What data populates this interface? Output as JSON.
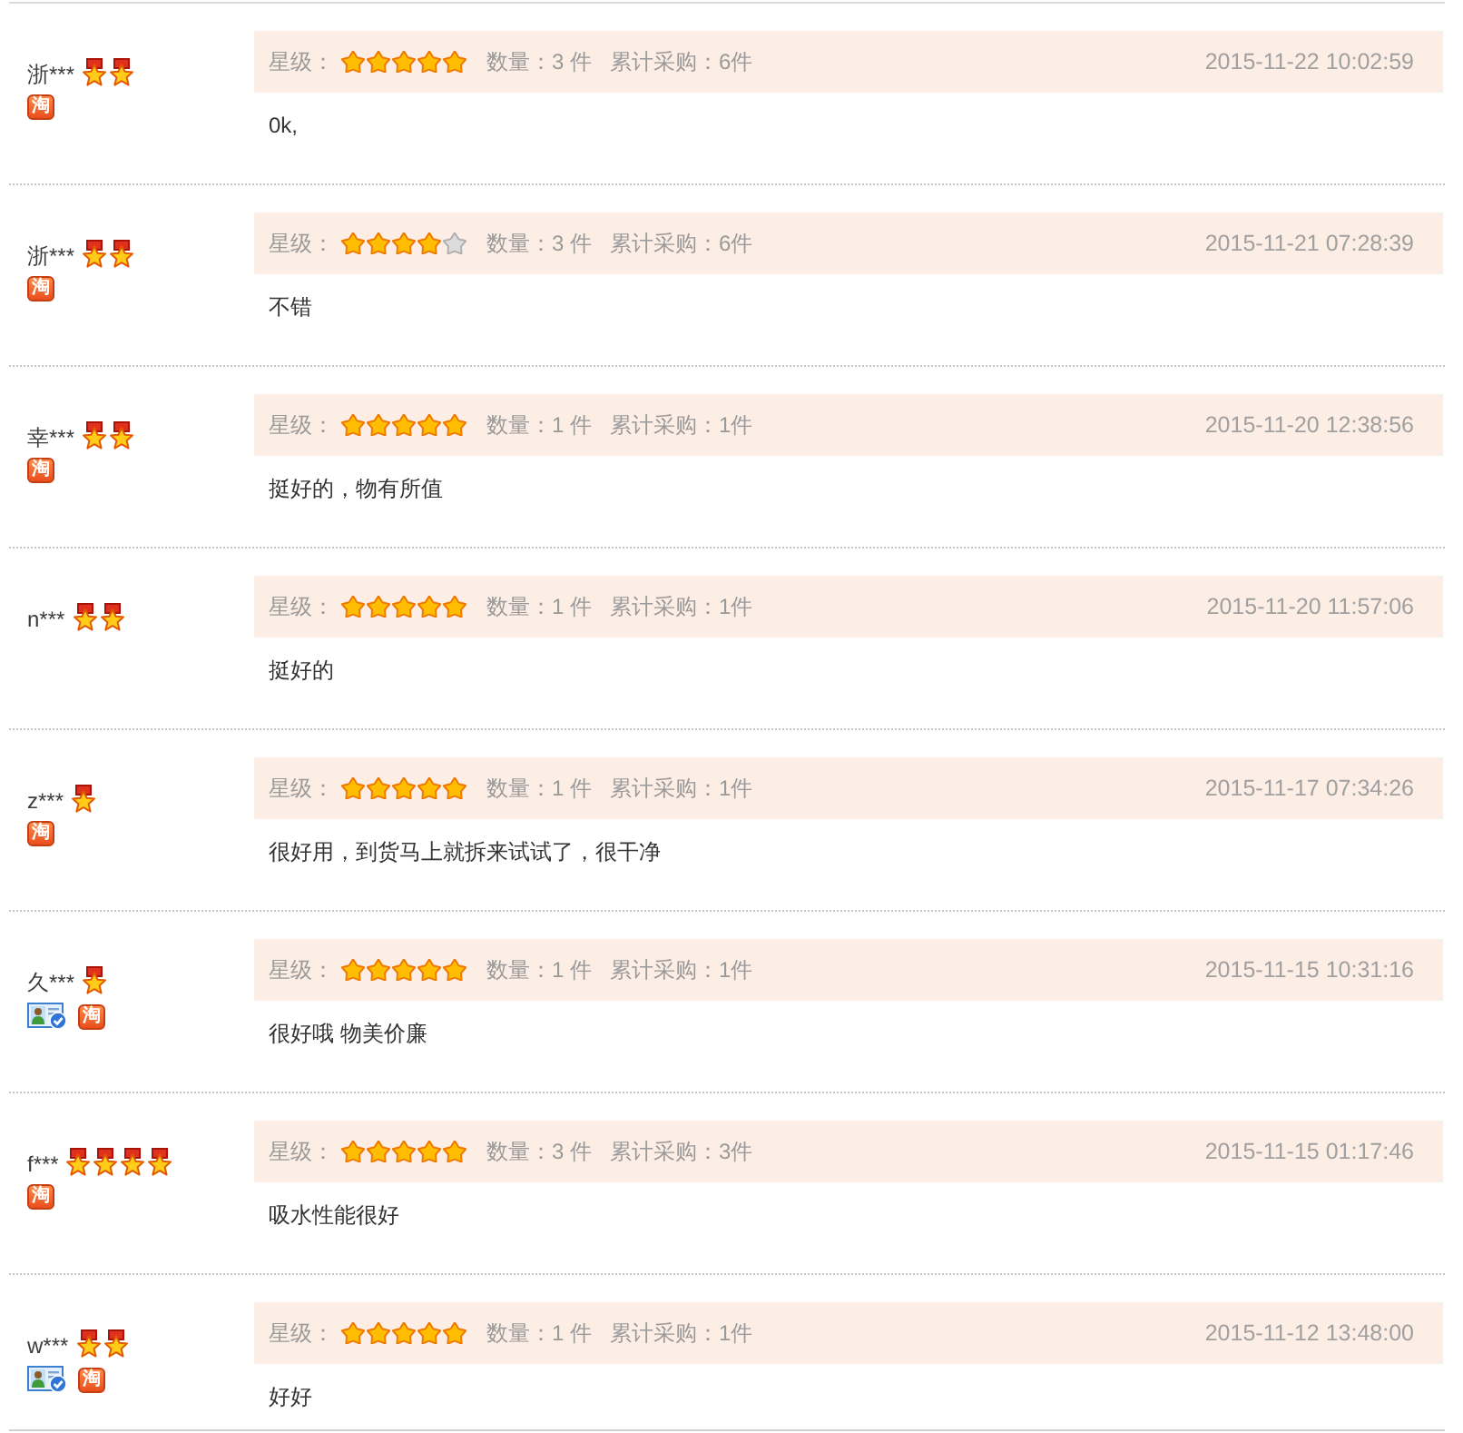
{
  "reviews": [
    {
      "user": {
        "name": "浙***",
        "medals": [
          {
            "kind": "medal"
          },
          {
            "kind": "medal"
          }
        ],
        "badges": [
          {
            "kind": "taobao",
            "label": "淘"
          }
        ]
      },
      "rating_label": "星级：",
      "stars": 5,
      "quantity": "数量：3 件",
      "total_purchased": "累计采购：6件",
      "date": "2015-11-22 10:02:59",
      "comment": "0k,"
    },
    {
      "user": {
        "name": "浙***",
        "medals": [
          {
            "kind": "medal"
          },
          {
            "kind": "medal"
          }
        ],
        "badges": [
          {
            "kind": "taobao",
            "label": "淘"
          }
        ]
      },
      "rating_label": "星级：",
      "stars": 4,
      "quantity": "数量：3 件",
      "total_purchased": "累计采购：6件",
      "date": "2015-11-21 07:28:39",
      "comment": "不错"
    },
    {
      "user": {
        "name": "幸***",
        "medals": [
          {
            "kind": "medal"
          },
          {
            "kind": "medal"
          }
        ],
        "badges": [
          {
            "kind": "taobao",
            "label": "淘"
          }
        ]
      },
      "rating_label": "星级：",
      "stars": 5,
      "quantity": "数量：1 件",
      "total_purchased": "累计采购：1件",
      "date": "2015-11-20 12:38:56",
      "comment": "挺好的，物有所值"
    },
    {
      "user": {
        "name": "n***",
        "medals": [
          {
            "kind": "medal"
          },
          {
            "kind": "medal"
          }
        ]
      },
      "rating_label": "星级：",
      "stars": 5,
      "quantity": "数量：1 件",
      "total_purchased": "累计采购：1件",
      "date": "2015-11-20 11:57:06",
      "comment": "挺好的"
    },
    {
      "user": {
        "name": "z***",
        "medals": [
          {
            "kind": "medal"
          }
        ],
        "badges": [
          {
            "kind": "taobao",
            "label": "淘"
          }
        ]
      },
      "rating_label": "星级：",
      "stars": 5,
      "quantity": "数量：1 件",
      "total_purchased": "累计采购：1件",
      "date": "2015-11-17 07:34:26",
      "comment": "很好用，到货马上就拆来试试了，很干净"
    },
    {
      "user": {
        "name": "久***",
        "medals": [
          {
            "kind": "medal"
          }
        ],
        "badges": [
          {
            "kind": "id-verified"
          },
          {
            "kind": "taobao",
            "label": "淘"
          }
        ]
      },
      "rating_label": "星级：",
      "stars": 5,
      "quantity": "数量：1 件",
      "total_purchased": "累计采购：1件",
      "date": "2015-11-15 10:31:16",
      "comment": "很好哦 物美价廉"
    },
    {
      "user": {
        "name": "f***",
        "medals": [
          {
            "kind": "medal"
          },
          {
            "kind": "medal"
          },
          {
            "kind": "medal"
          },
          {
            "kind": "medal"
          }
        ],
        "badges": [
          {
            "kind": "taobao",
            "label": "淘"
          }
        ]
      },
      "rating_label": "星级：",
      "stars": 5,
      "quantity": "数量：3 件",
      "total_purchased": "累计采购：3件",
      "date": "2015-11-15 01:17:46",
      "comment": "吸水性能很好"
    },
    {
      "user": {
        "name": "w***",
        "medals": [
          {
            "kind": "medal"
          },
          {
            "kind": "medal"
          }
        ],
        "badges": [
          {
            "kind": "id-verified"
          },
          {
            "kind": "taobao",
            "label": "淘"
          }
        ]
      },
      "rating_label": "星级：",
      "stars": 5,
      "quantity": "数量：1 件",
      "total_purchased": "累计采购：1件",
      "date": "2015-11-12 13:48:00",
      "comment": "好好"
    }
  ]
}
